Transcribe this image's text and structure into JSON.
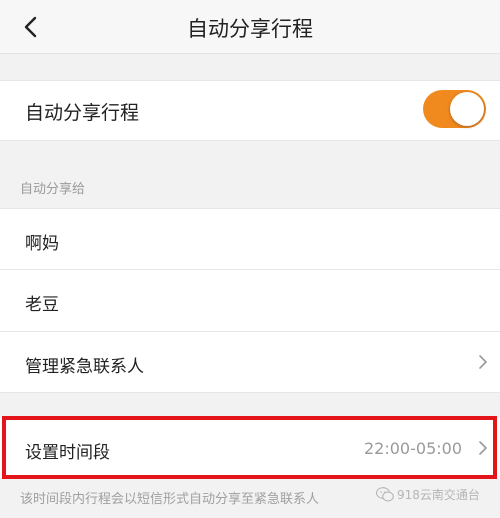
{
  "nav": {
    "title": "自动分享行程",
    "back_icon": "chevron-left-icon"
  },
  "auto_share": {
    "label": "自动分享行程",
    "toggle_on": true,
    "toggle_color": "#f08a1f"
  },
  "section": {
    "title": "自动分享给"
  },
  "contacts": [
    {
      "name": "啊妈"
    },
    {
      "name": "老豆"
    }
  ],
  "manage": {
    "label": "管理紧急联系人"
  },
  "time_period": {
    "label": "设置时间段",
    "value": "22:00-05:00"
  },
  "footnote": "该时间段内行程会以短信形式自动分享至紧急联系人",
  "watermark": "918云南交通台",
  "highlight_color": "#e4141b"
}
